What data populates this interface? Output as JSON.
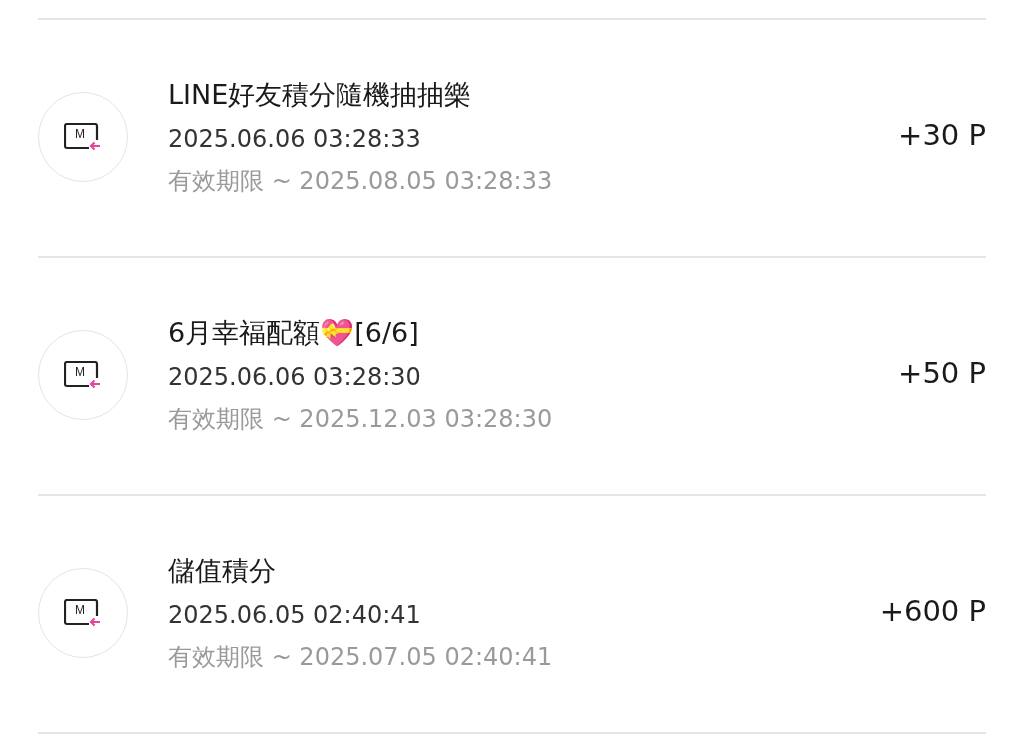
{
  "records": [
    {
      "icon_label": "M",
      "title": "LINE好友積分隨機抽抽樂",
      "date": "2025.06.06 03:28:33",
      "expiry": "有效期限 ~ 2025.08.05 03:28:33",
      "points": "+30 P"
    },
    {
      "icon_label": "M",
      "title": "6月幸福配額💝[6/6]",
      "date": "2025.06.06 03:28:30",
      "expiry": "有效期限 ~ 2025.12.03 03:28:30",
      "points": "+50 P"
    },
    {
      "icon_label": "M",
      "title": "儲值積分",
      "date": "2025.06.05 02:40:41",
      "expiry": "有效期限 ~ 2025.07.05 02:40:41",
      "points": "+600 P"
    }
  ]
}
